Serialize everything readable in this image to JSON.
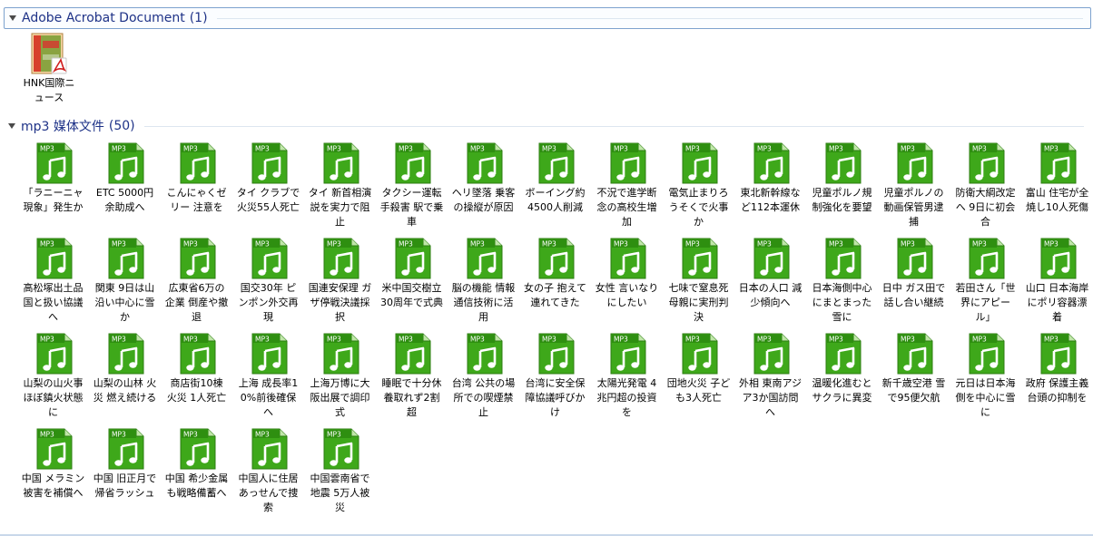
{
  "groups": {
    "pdf": {
      "title": "Adobe Acrobat Document",
      "count": "(1)"
    },
    "mp3": {
      "title": "mp3 媒体文件",
      "count": "(50)"
    }
  },
  "pdf_file": {
    "name": "HNK国際ニュース",
    "icon": "pdf-file-icon"
  },
  "mp3_icon": {
    "badge": "MP3",
    "icon": "music-note-icon",
    "color": "#3ea81a"
  },
  "mp3_files": [
    "「ラニーニャ現象」発生か",
    "ETC 5000円余助成へ",
    "こんにゃくゼリー 注意を",
    "タイ クラブで火災55人死亡",
    "タイ 新首相演説を実力で阻止",
    "タクシー運転手殺害 駅で乗車",
    "ヘリ墜落 乗客の操縦が原因",
    "ボーイング約4500人削減",
    "不況で進学断念の高校生増加",
    "電気止まりろうそくで火事か",
    "東北新幹線など112本運休",
    "児童ポルノ規制強化を要望",
    "児童ポルノの動画保管男逮捕",
    "防衛大綱改定へ 9日に初会合",
    "富山 住宅が全焼し10人死傷",
    "高松塚出土品 国と扱い協議へ",
    "関東 9日は山沿い中心に雪か",
    "広東省6万の企業 倒産や撤退",
    "国交30年 ピンポン外交再現",
    "国連安保理 ガザ停戦決議採択",
    "米中国交樹立30周年で式典",
    "脳の機能 情報通信技術に活用",
    "女の子 抱えて連れてきた",
    "女性 言いなりにしたい",
    "七味で窒息死 母親に実刑判決",
    "日本の人口 減少傾向へ",
    "日本海側中心にまとまった雪に",
    "日中 ガス田で話し合い継続",
    "若田さん「世界にアピール」",
    "山口 日本海岸にポリ容器漂着",
    "山梨の山火事 ほぼ鎮火状態に",
    "山梨の山林 火災 燃え続ける",
    "商店街10棟 火災 1人死亡",
    "上海 成長率10%前後確保へ",
    "上海万博に大阪出展で調印式",
    "睡眠で十分休養取れず2割超",
    "台湾 公共の場所での喫煙禁止",
    "台湾に安全保障協議呼びかけ",
    "太陽光発電 4兆円超の投資を",
    "団地火災 子ども3人死亡",
    "外相 東南アジア3か国訪問へ",
    "温暖化進むとサクラに異変",
    "新千歳空港 雪で95便欠航",
    "元日は日本海側を中心に雪に",
    "政府 保護主義台頭の抑制を",
    "中国 メラミン被害を補償へ",
    "中国 旧正月で帰省ラッシュ",
    "中国 希少金属も戦略備蓄へ",
    "中国人に住居あっせんで捜索",
    "中国雲南省で地震 5万人被災"
  ]
}
